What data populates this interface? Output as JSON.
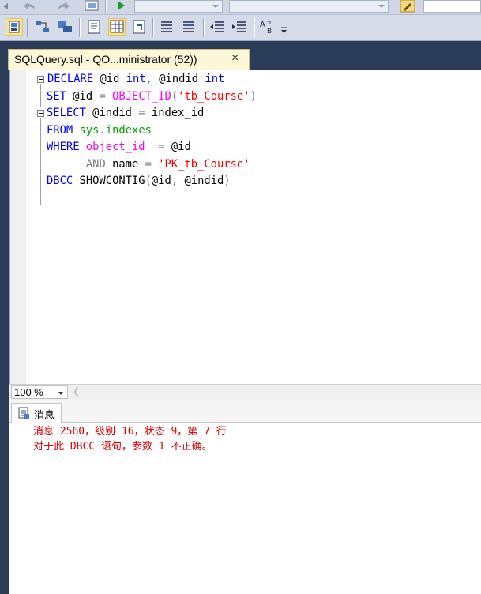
{
  "toolbar": {
    "row1_icons": [
      "scroll-left-arrow",
      "undo-icon",
      "redo-icon",
      "display-plan-icon",
      "execute-icon",
      "database-combo",
      "object-combo",
      "pencil-icon",
      "search-box"
    ],
    "row2_icons": [
      "save-results-icon",
      "design-query-icon",
      "specify-values-icon",
      "results-to-text-icon",
      "results-to-grid-icon",
      "results-to-file-icon",
      "comment-icon",
      "uncomment-icon",
      "decrease-indent-icon",
      "increase-indent-icon",
      "specify-template-icon"
    ],
    "accent": "#fbe28d"
  },
  "document_tab": {
    "title": "SQLQuery.sql - QO...ministrator (52))",
    "close_symbol": "×"
  },
  "editor": {
    "lines": [
      [
        {
          "t": "DECLARE",
          "c": "kw"
        },
        {
          "t": " @id ",
          "c": "txt"
        },
        {
          "t": "int",
          "c": "kw"
        },
        {
          "t": ", ",
          "c": "gray"
        },
        {
          "t": "@indid ",
          "c": "txt"
        },
        {
          "t": "int",
          "c": "kw"
        }
      ],
      [
        {
          "t": "SET",
          "c": "kw"
        },
        {
          "t": " @id ",
          "c": "txt"
        },
        {
          "t": "=",
          "c": "gray"
        },
        {
          "t": " ",
          "c": "txt"
        },
        {
          "t": "OBJECT_ID",
          "c": "fn"
        },
        {
          "t": "(",
          "c": "gray"
        },
        {
          "t": "'tb_Course'",
          "c": "str"
        },
        {
          "t": ")",
          "c": "gray"
        }
      ],
      [
        {
          "t": "SELECT",
          "c": "kw"
        },
        {
          "t": " @indid ",
          "c": "txt"
        },
        {
          "t": "=",
          "c": "gray"
        },
        {
          "t": " index_id",
          "c": "txt"
        }
      ],
      [
        {
          "t": "FROM",
          "c": "kw"
        },
        {
          "t": " ",
          "c": "txt"
        },
        {
          "t": "sys",
          "c": "sys"
        },
        {
          "t": ".",
          "c": "gray"
        },
        {
          "t": "indexes",
          "c": "sys"
        }
      ],
      [
        {
          "t": "WHERE",
          "c": "kw"
        },
        {
          "t": " ",
          "c": "txt"
        },
        {
          "t": "object_id",
          "c": "fn"
        },
        {
          "t": "  ",
          "c": "txt"
        },
        {
          "t": "=",
          "c": "gray"
        },
        {
          "t": " @id",
          "c": "txt"
        }
      ],
      [
        {
          "t": "      ",
          "c": "txt"
        },
        {
          "t": "AND",
          "c": "gray"
        },
        {
          "t": " name ",
          "c": "txt"
        },
        {
          "t": "=",
          "c": "gray"
        },
        {
          "t": " ",
          "c": "txt"
        },
        {
          "t": "'PK_tb_Course'",
          "c": "str"
        }
      ],
      [
        {
          "t": "DBCC",
          "c": "kw"
        },
        {
          "t": " SHOWCONTIG",
          "c": "txt"
        },
        {
          "t": "(",
          "c": "gray"
        },
        {
          "t": "@id",
          "c": "txt"
        },
        {
          "t": ", ",
          "c": "gray"
        },
        {
          "t": "@indid",
          "c": "txt"
        },
        {
          "t": ")",
          "c": "gray"
        }
      ]
    ]
  },
  "zoom": {
    "value": "100 %"
  },
  "results": {
    "tab_label": "消息",
    "messages": [
      "消息 2560，级别 16，状态 9，第 7 行",
      "对于此 DBCC 语句，参数 1 不正确。"
    ],
    "message_color": "#e00000"
  }
}
